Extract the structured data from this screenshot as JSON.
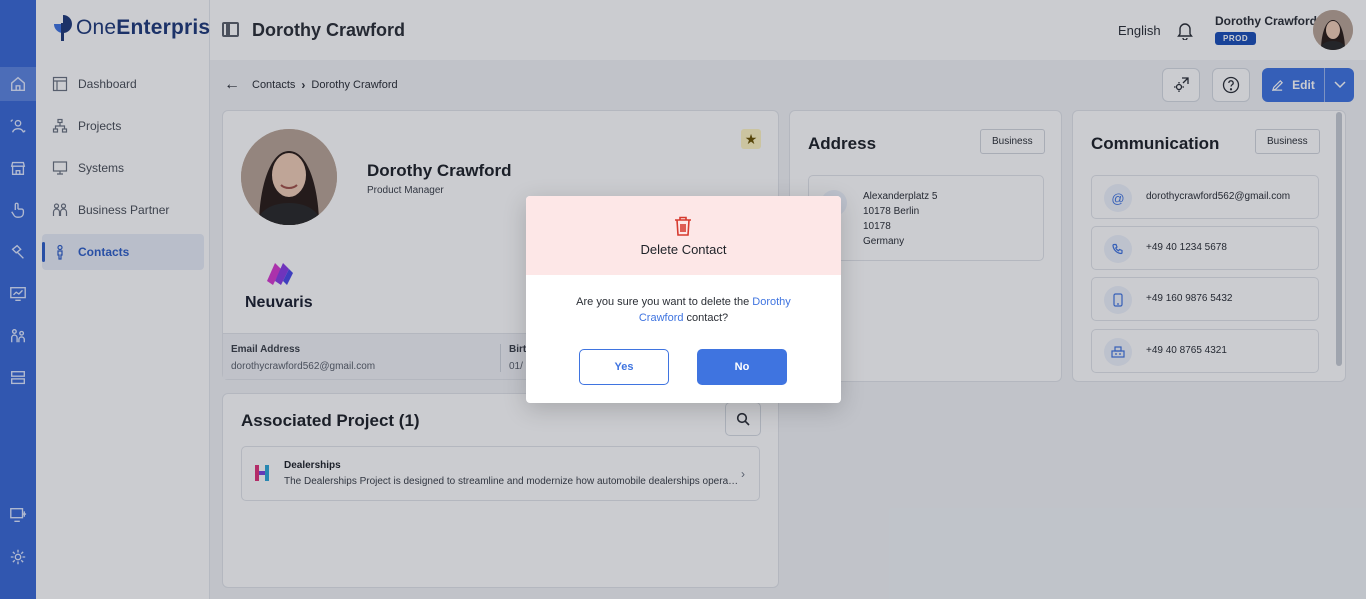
{
  "app": {
    "logo_prefix": "One",
    "logo_suffix": "Enterprise"
  },
  "colors": {
    "primary": "#3f74e0",
    "rail": "#3a6ad6",
    "danger": "#d63a2f",
    "modal_header": "#fde7e7",
    "prod_badge": "#1a4fb8"
  },
  "rail": {
    "icons": [
      "home-icon",
      "contacts-switch-icon",
      "store-icon",
      "hand-icon",
      "hammer-icon",
      "monitor-chart-icon",
      "people-icon",
      "server-icon",
      "display-settings-icon",
      "settings-icon"
    ]
  },
  "sidebar": {
    "items": [
      {
        "label": "Dashboard",
        "icon": "dashboard-icon"
      },
      {
        "label": "Projects",
        "icon": "projects-icon"
      },
      {
        "label": "Systems",
        "icon": "systems-icon"
      },
      {
        "label": "Business Partner",
        "icon": "business-partner-icon"
      },
      {
        "label": "Contacts",
        "icon": "contacts-icon",
        "active": true
      }
    ]
  },
  "header": {
    "title": "Dorothy Crawford",
    "language": "English",
    "user_name": "Dorothy Crawford",
    "env_badge": "PROD"
  },
  "breadcrumb": {
    "parent": "Contacts",
    "current": "Dorothy Crawford"
  },
  "toolbar": {
    "edit_label": "Edit"
  },
  "profile": {
    "name": "Dorothy Crawford",
    "role": "Product Manager",
    "company": "Neuvaris",
    "email_label": "Email Address",
    "email": "dorothycrawford562@gmail.com",
    "second_label": "Birt",
    "second_value": "01/"
  },
  "projects": {
    "title": "Associated Project (1)",
    "items": [
      {
        "name": "Dealerships",
        "description": "The Dealerships Project is designed to streamline and modernize how automobile dealerships operat..."
      }
    ]
  },
  "address": {
    "title": "Address",
    "type": "Business",
    "lines": [
      "Alexanderplatz 5",
      "10178 Berlin",
      "10178",
      "Germany"
    ]
  },
  "communication": {
    "title": "Communication",
    "type": "Business",
    "items": [
      {
        "icon": "at-icon",
        "value": "dorothycrawford562@gmail.com"
      },
      {
        "icon": "phone-icon",
        "value": "+49 40 1234 5678"
      },
      {
        "icon": "mobile-icon",
        "value": "+49 160 9876 5432"
      },
      {
        "icon": "fax-icon",
        "value": "+49 40 8765 4321"
      }
    ]
  },
  "modal": {
    "title": "Delete Contact",
    "message_pre": "Are you sure you want to delete the ",
    "message_name": "Dorothy Crawford",
    "message_post": " contact?",
    "yes_label": "Yes",
    "no_label": "No"
  }
}
